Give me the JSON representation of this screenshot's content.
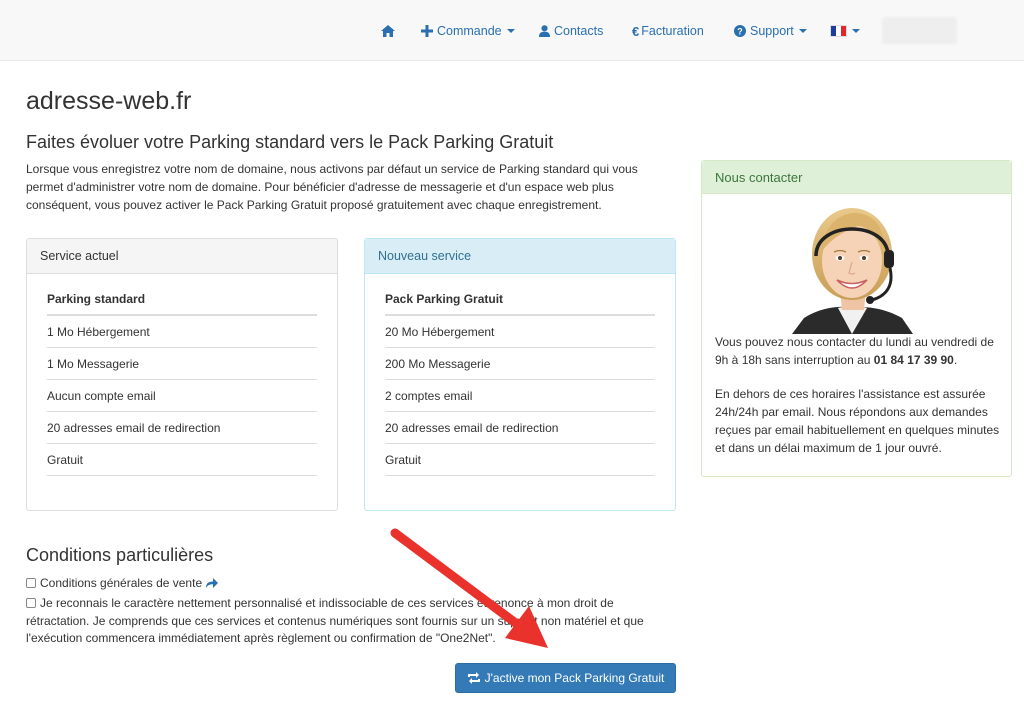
{
  "navbar": {
    "home_icon": "home-icon",
    "commande": "Commande",
    "contacts": "Contacts",
    "facturation": "Facturation",
    "support": "Support",
    "language_flag": "fr-flag-icon"
  },
  "page": {
    "site_title": "adresse-web.fr",
    "section_title": "Faites évoluer votre Parking standard vers le Pack Parking Gratuit",
    "intro": "Lorsque vous enregistrez votre nom de domaine, nous activons par défaut un service de Parking standard qui vous permet d'administrer votre nom de domaine. Pour bénéficier d'adresse de messagerie et d'un espace web plus conséquent, vous pouvez activer le Pack Parking Gratuit proposé gratuitement avec chaque enregistrement."
  },
  "current_service": {
    "heading": "Service actuel",
    "items": [
      "Parking standard",
      "1 Mo Hébergement",
      "1 Mo Messagerie",
      "Aucun compte email",
      "20 adresses email de redirection",
      "Gratuit"
    ]
  },
  "new_service": {
    "heading": "Nouveau service",
    "items": [
      "Pack Parking Gratuit",
      "20 Mo Hébergement",
      "200 Mo Messagerie",
      "2 comptes email",
      "20 adresses email de redirection",
      "Gratuit"
    ]
  },
  "contact": {
    "heading": "Nous contacter",
    "text1": "Vous pouvez nous contacter du lundi au vendredi de 9h à 18h sans interruption au ",
    "phone": "01 84 17 39 90",
    "text1_end": ".",
    "text2": "En dehors de ces horaires l'assistance est assurée 24h/24h par email. Nous répondons aux demandes reçues par email habituellement en quelques minutes et dans un délai maximum de 1 jour ouvré."
  },
  "conditions": {
    "title": "Conditions particulières",
    "cgv": "Conditions générales de vente",
    "retractation": "Je reconnais le caractère nettement personnalisé et indissociable de ces services et renonce à mon droit de rétractation. Je comprends que ces services et contenus numériques sont fournis sur un support non matériel et que l'exécution commencera immédiatement après règlement ou confirmation de \"One2Net\"."
  },
  "activate_button": "J'active mon Pack Parking Gratuit",
  "colors": {
    "primary": "#337ab7",
    "link": "#2a6fb0",
    "annotation_arrow": "#e8322b"
  }
}
